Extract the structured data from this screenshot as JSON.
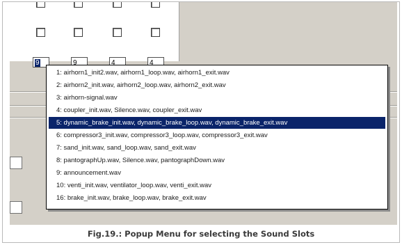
{
  "number_fields": [
    "9",
    "9",
    "4",
    "4"
  ],
  "popup_menu": {
    "items": [
      "1: airhorn1_init2.wav, airhorn1_loop.wav, airhorn1_exit.wav",
      "2: airhorn2_init.wav, airhorn2_loop.wav, airhorn2_exit.wav",
      "3: airhorn-signal.wav",
      "4: coupler_init.wav, Silence.wav, coupler_exit.wav",
      "5: dynamic_brake_init.wav, dynamic_brake_loop.wav, dynamic_brake_exit.wav",
      "6: compressor3_init.wav, compressor3_loop.wav, compressor3_exit.wav",
      "7: sand_init.wav, sand_loop.wav, sand_exit.wav",
      "8: pantographUp.wav, Silence.wav, pantographDown.wav",
      "9: announcement.wav",
      "10: venti_init.wav, ventilator_loop.wav, venti_exit.wav",
      "16: brake_init.wav, brake_loop.wav, brake_exit.wav"
    ],
    "highlighted_index": 4
  },
  "caption": "Fig.19.: Popup Menu for selecting the Sound Slots",
  "colors": {
    "selection": "#0a246a",
    "window_grey": "#d4d0c8"
  }
}
